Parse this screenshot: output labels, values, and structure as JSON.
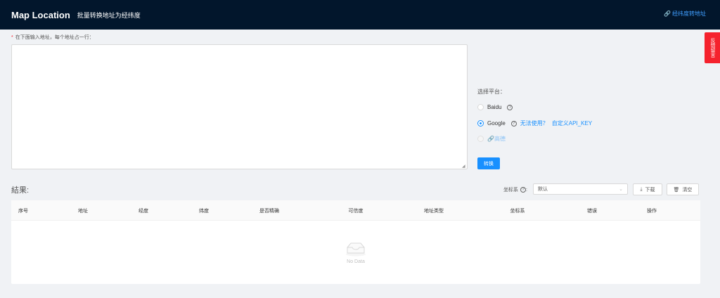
{
  "header": {
    "title": "Map Location",
    "subtitle": "批量转换地址为经纬度",
    "reverse_link": "经纬度转地址"
  },
  "feedback": {
    "label": "反馈留言"
  },
  "input": {
    "required_mark": "*",
    "label": "在下面输入地址，每个地址占一行：",
    "value": ""
  },
  "platform": {
    "label": "选择平台：",
    "options": [
      {
        "label": "Baidu",
        "selected": false
      },
      {
        "label": "Google",
        "selected": true,
        "links": [
          "无法使用？",
          "自定义API_KEY"
        ]
      },
      {
        "label": "高德",
        "selected": false
      }
    ]
  },
  "convert_button": "转换",
  "results": {
    "title": "結果:",
    "coord_label": "坐标系",
    "coord_value": "默认",
    "download_label": "下载",
    "clear_label": "清空",
    "columns": [
      "序号",
      "地址",
      "经度",
      "纬度",
      "是否精确",
      "可信度",
      "地址类型",
      "坐标系",
      "错误",
      "操作"
    ],
    "rows": [],
    "empty_text": "No Data"
  },
  "colors": {
    "header_bg": "#02162c",
    "primary": "#1890ff",
    "feedback_bg": "#f5222d"
  }
}
